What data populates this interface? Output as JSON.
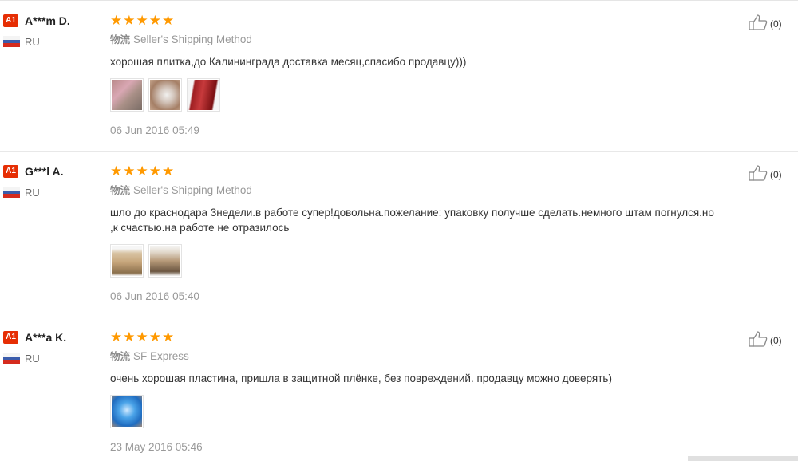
{
  "reviews": [
    {
      "badge": "A1",
      "username": "A***m D.",
      "country": "RU",
      "rating": 5,
      "shipping_label": "物流",
      "shipping_method": "Seller's Shipping Method",
      "text": "хорошая плитка,до Калининграда доставка месяц,спасибо продавцу)))",
      "photo_count": 3,
      "date": "06 Jun 2016 05:49",
      "helpful": "(0)"
    },
    {
      "badge": "A1",
      "username": "G***l A.",
      "country": "RU",
      "rating": 5,
      "shipping_label": "物流",
      "shipping_method": "Seller's Shipping Method",
      "text": "шло до краснодара 3недели.в работе супер!довольна.пожелание: упаковку получше сделать.немного штам погнулся.но ,к счастью.на работе не отразилось",
      "photo_count": 2,
      "date": "06 Jun 2016 05:40",
      "helpful": "(0)"
    },
    {
      "badge": "A1",
      "username": "A***a K.",
      "country": "RU",
      "rating": 5,
      "shipping_label": "物流",
      "shipping_method": "SF Express",
      "text": "очень хорошая пластина, пришла в защитной плёнке, без повреждений. продавцу можно доверять)",
      "photo_count": 1,
      "date": "23 May 2016 05:46",
      "helpful": "(0)"
    }
  ],
  "icons": {
    "star": "star-icon",
    "thumbs_up": "thumbs-up-icon",
    "flag": "russia-flag-icon"
  },
  "colors": {
    "star": "#ff9900",
    "badge": "#e62e04",
    "muted_text": "#999999"
  }
}
